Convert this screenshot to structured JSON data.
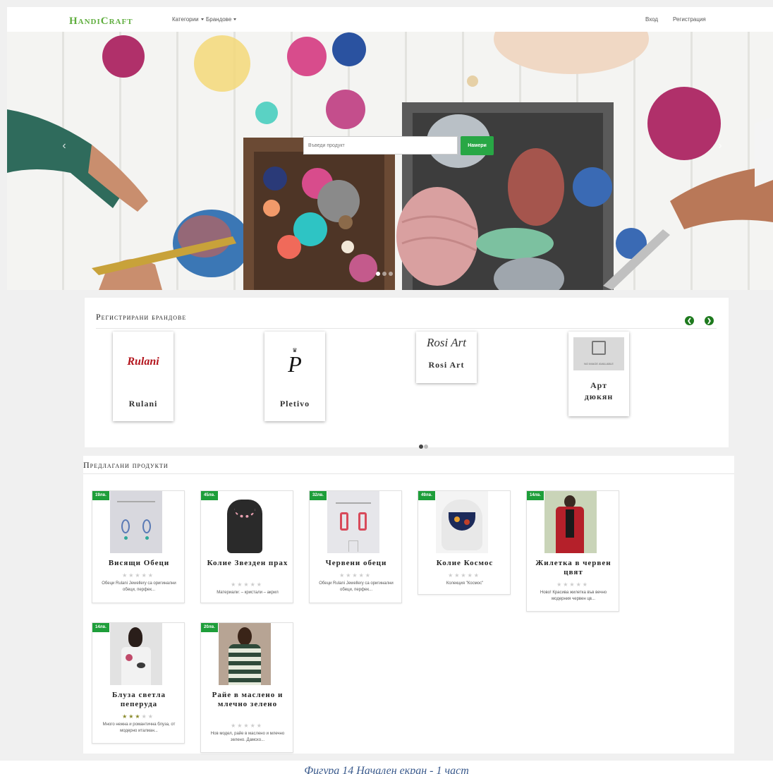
{
  "navbar": {
    "logo_part1": "HandiCraft",
    "logo_part2": "",
    "categories_label": "Категории",
    "brands_label": "Брандове",
    "login_label": "Вход",
    "register_label": "Регистрация"
  },
  "hero": {
    "search_placeholder": "Въведи продукт",
    "search_button": "Намери",
    "slide_count": 3,
    "active_slide": 1
  },
  "brands": {
    "title": "Регистрирани брандове",
    "items": [
      {
        "name": "Rulani",
        "logo_text": "Rulani"
      },
      {
        "name": "Pletivo",
        "logo_text": "P"
      },
      {
        "name": "Rosi Art",
        "logo_text": "Rosi Art"
      },
      {
        "name": "Арт дюкян",
        "logo_text": "NO IMAGE AVAILABLE"
      }
    ],
    "page_count": 2,
    "active_page": 1
  },
  "products": {
    "title": "Предлагани продукти",
    "items": [
      {
        "price": "19лв.",
        "name": "Висящи Обеци",
        "rating": 0,
        "desc": "Обеци Rulani Jewellery са оригинални обеци, перфек..."
      },
      {
        "price": "45лв.",
        "name": "Колие Звезден прах",
        "rating": 0,
        "desc": "Материали: – кристали – акрил"
      },
      {
        "price": "32лв.",
        "name": "Червени обеци",
        "rating": 0,
        "desc": "Обеци Rulani Jewellery са оригинални обеци, перфек..."
      },
      {
        "price": "49лв.",
        "name": "Колие Космос",
        "rating": 0,
        "desc": "Колекция \"Космос\""
      },
      {
        "price": "14лв.",
        "name": "Жилетка в червен цвят",
        "rating": 0,
        "desc": "Ново! Красива жилетка във вечно модерния червен цв..."
      },
      {
        "price": "14лв.",
        "name": "Блуза светла пеперуда",
        "rating": 3,
        "desc": "Много нежна и романтична блуза, от модерно италиан..."
      },
      {
        "price": "20лв.",
        "name": "Райе в маслено и млечно зелено",
        "rating": 0,
        "desc": "Нов модел, райе в маслено и млечно зелено. Дамско..."
      }
    ]
  },
  "caption": "Фигура 14 Начален екран - 1 част",
  "colors": {
    "accent_green": "#28a745",
    "badge_green": "#1e9e3a",
    "logo_green": "#5fae3e"
  },
  "icons": {
    "carousel_prev": "chevron-left-icon",
    "carousel_next": "chevron-right-icon",
    "star": "star-icon"
  }
}
